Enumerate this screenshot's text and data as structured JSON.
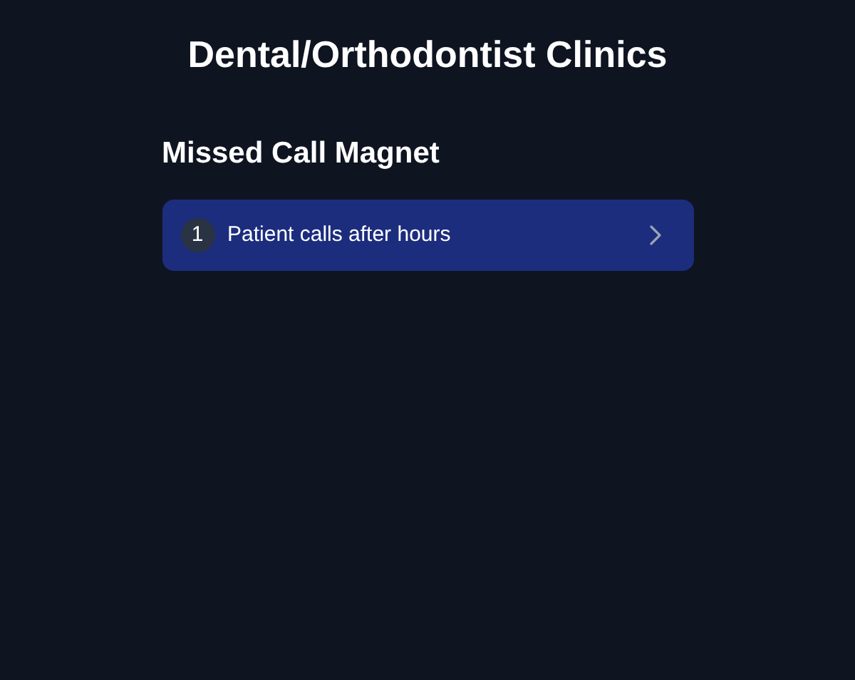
{
  "title": "Dental/Orthodontist Clinics",
  "section": {
    "heading": "Missed Call Magnet",
    "items": [
      {
        "number": "1",
        "label": "Patient calls after hours",
        "selected": true
      }
    ]
  }
}
